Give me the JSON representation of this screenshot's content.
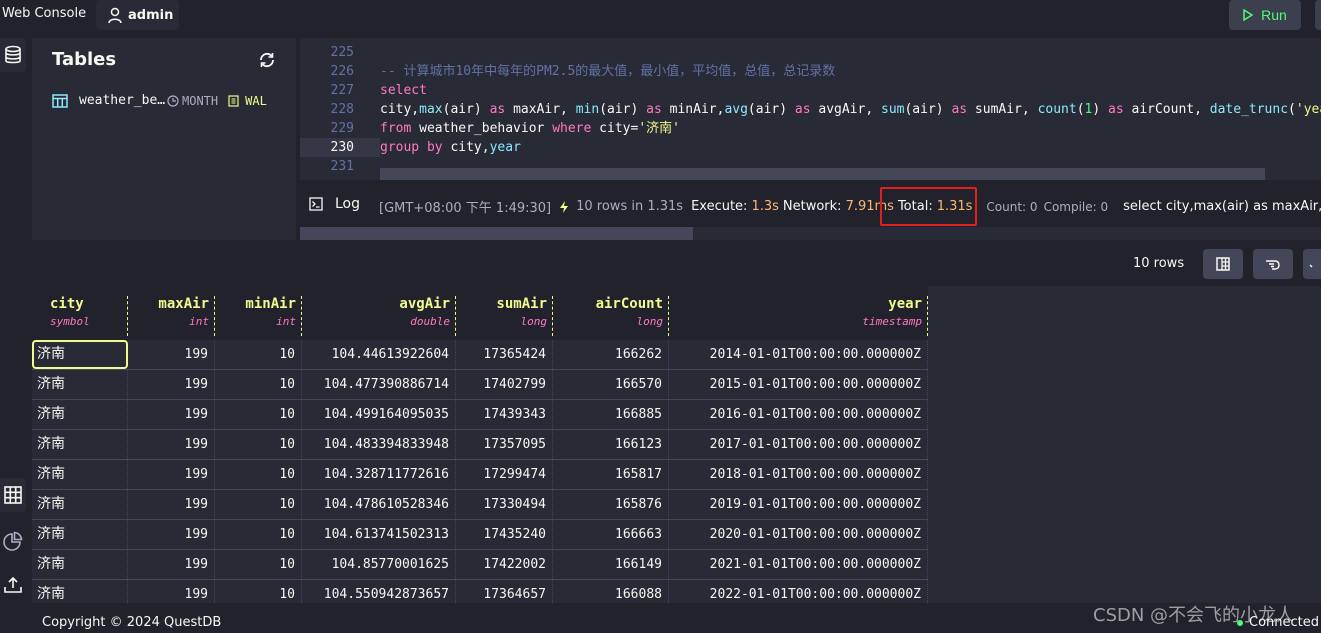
{
  "topbar": {
    "brand": "Web Console",
    "user": "admin",
    "run_label": "Run"
  },
  "tables_panel": {
    "title": "Tables",
    "items": [
      {
        "name": "weather_be…",
        "partition": "MONTH",
        "wal": "WAL"
      }
    ]
  },
  "editor": {
    "lines": [
      {
        "n": "225",
        "tokens": []
      },
      {
        "n": "226",
        "tokens": [
          {
            "t": "cmt",
            "v": "-- 计算城市10年中每年的PM2.5的最大值，最小值，平均值，总值，总记录数"
          }
        ]
      },
      {
        "n": "227",
        "tokens": [
          {
            "t": "kw",
            "v": "select"
          }
        ]
      },
      {
        "n": "228",
        "tokens": [
          {
            "t": "",
            "v": "city,"
          },
          {
            "t": "fn",
            "v": "max"
          },
          {
            "t": "",
            "v": "(air) "
          },
          {
            "t": "kw",
            "v": "as"
          },
          {
            "t": "",
            "v": " maxAir, "
          },
          {
            "t": "fn",
            "v": "min"
          },
          {
            "t": "",
            "v": "(air) "
          },
          {
            "t": "kw",
            "v": "as"
          },
          {
            "t": "",
            "v": " minAir,"
          },
          {
            "t": "fn",
            "v": "avg"
          },
          {
            "t": "",
            "v": "(air) "
          },
          {
            "t": "kw",
            "v": "as"
          },
          {
            "t": "",
            "v": " avgAir, "
          },
          {
            "t": "fn",
            "v": "sum"
          },
          {
            "t": "",
            "v": "(air) "
          },
          {
            "t": "kw",
            "v": "as"
          },
          {
            "t": "",
            "v": " sumAir, "
          },
          {
            "t": "fn",
            "v": "count"
          },
          {
            "t": "",
            "v": "("
          },
          {
            "t": "num",
            "v": "1"
          },
          {
            "t": "",
            "v": ") "
          },
          {
            "t": "kw",
            "v": "as"
          },
          {
            "t": "",
            "v": " airCount, "
          },
          {
            "t": "fn",
            "v": "date_trunc"
          },
          {
            "t": "",
            "v": "("
          },
          {
            "t": "str",
            "v": "'year"
          }
        ]
      },
      {
        "n": "229",
        "tokens": [
          {
            "t": "kw",
            "v": "from"
          },
          {
            "t": "",
            "v": " weather_behavior "
          },
          {
            "t": "kw",
            "v": "where"
          },
          {
            "t": "",
            "v": " city="
          },
          {
            "t": "str",
            "v": "'济南'"
          }
        ]
      },
      {
        "n": "230",
        "current": true,
        "tokens": [
          {
            "t": "kw",
            "v": "group by"
          },
          {
            "t": "",
            "v": " city,"
          },
          {
            "t": "fn",
            "v": "year"
          }
        ]
      },
      {
        "n": "231",
        "tokens": []
      }
    ]
  },
  "log": {
    "label": "Log",
    "timestamp": "[GMT+08:00 下午 1:49:30]",
    "rows_msg": "10 rows in 1.31s",
    "execute_label": "Execute:",
    "execute_value": "1.3s",
    "network_label": "Network:",
    "network_value": "7.91ms",
    "total_label": "Total:",
    "total_value": "1.31s",
    "count_label": "Count: 0",
    "compile_label": "Compile: 0",
    "query_preview": "select city,max(air) as maxAir, m"
  },
  "results": {
    "row_count": "10 rows",
    "columns": [
      {
        "name": "city",
        "type": "symbol"
      },
      {
        "name": "maxAir",
        "type": "int"
      },
      {
        "name": "minAir",
        "type": "int"
      },
      {
        "name": "avgAir",
        "type": "double"
      },
      {
        "name": "sumAir",
        "type": "long"
      },
      {
        "name": "airCount",
        "type": "long"
      },
      {
        "name": "year",
        "type": "timestamp"
      }
    ],
    "rows": [
      [
        "济南",
        "199",
        "10",
        "104.44613922604",
        "17365424",
        "166262",
        "2014-01-01T00:00:00.000000Z"
      ],
      [
        "济南",
        "199",
        "10",
        "104.477390886714",
        "17402799",
        "166570",
        "2015-01-01T00:00:00.000000Z"
      ],
      [
        "济南",
        "199",
        "10",
        "104.499164095035",
        "17439343",
        "166885",
        "2016-01-01T00:00:00.000000Z"
      ],
      [
        "济南",
        "199",
        "10",
        "104.483394833948",
        "17357095",
        "166123",
        "2017-01-01T00:00:00.000000Z"
      ],
      [
        "济南",
        "199",
        "10",
        "104.328711772616",
        "17299474",
        "165817",
        "2018-01-01T00:00:00.000000Z"
      ],
      [
        "济南",
        "199",
        "10",
        "104.478610528346",
        "17330494",
        "165876",
        "2019-01-01T00:00:00.000000Z"
      ],
      [
        "济南",
        "199",
        "10",
        "104.613741502313",
        "17435240",
        "166663",
        "2020-01-01T00:00:00.000000Z"
      ],
      [
        "济南",
        "199",
        "10",
        "104.85770001625",
        "17422002",
        "166149",
        "2021-01-01T00:00:00.000000Z"
      ],
      [
        "济南",
        "199",
        "10",
        "104.550942873657",
        "17364657",
        "166088",
        "2022-01-01T00:00:00.000000Z"
      ]
    ]
  },
  "footer": {
    "copyright": "Copyright © 2024 QuestDB",
    "status": "Connected",
    "watermark": "CSDN @不会飞的小龙人"
  },
  "colors": {
    "accent_green": "#50fa7b",
    "header_yellow": "#f1fa8c",
    "type_pink": "#ff79c6",
    "timing_orange": "#ffb86c",
    "highlight_red": "#e02020"
  }
}
